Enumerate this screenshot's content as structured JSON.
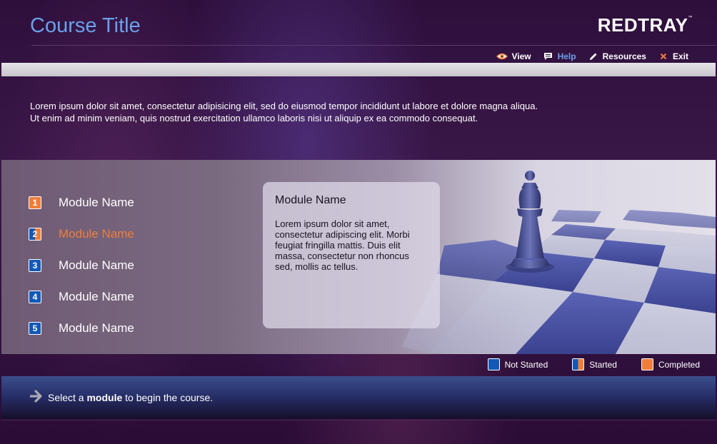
{
  "header": {
    "course_title": "Course Title",
    "logo_text": "REDTRAY",
    "logo_mark": "™"
  },
  "toolbar": {
    "items": [
      {
        "label": "View",
        "icon": "eye-icon",
        "active": false
      },
      {
        "label": "Help",
        "icon": "chat-icon",
        "active": true
      },
      {
        "label": "Resources",
        "icon": "pencil-icon",
        "active": false
      },
      {
        "label": "Exit",
        "icon": "close-icon",
        "active": false
      }
    ]
  },
  "intro": {
    "line1": "Lorem ipsum dolor sit amet, consectetur adipisicing elit, sed do eiusmod tempor incididunt ut labore et dolore magna aliqua.",
    "line2": "Ut enim ad minim veniam, quis nostrud exercitation ullamco laboris nisi ut aliquip ex ea commodo consequat."
  },
  "modules": [
    {
      "number": "1",
      "label": "Module Name",
      "status": "completed"
    },
    {
      "number": "2",
      "label": "Module Name",
      "status": "started"
    },
    {
      "number": "3",
      "label": "Module Name",
      "status": "notstarted"
    },
    {
      "number": "4",
      "label": "Module Name",
      "status": "notstarted"
    },
    {
      "number": "5",
      "label": "Module Name",
      "status": "notstarted"
    }
  ],
  "detail": {
    "title": "Module Name",
    "body": "Lorem ipsum dolor sit amet, consectetur adipiscing elit. Morbi feugiat fringilla mattis. Duis elit massa, consectetur non rhoncus sed, mollis ac tellus."
  },
  "legend": {
    "not_started": "Not Started",
    "started": "Started",
    "completed": "Completed"
  },
  "footer": {
    "text_before": "Select a",
    "text_bold": "module",
    "text_after": "to begin the course."
  },
  "colors": {
    "accent_blue": "#6aa0ea",
    "status_orange": "#f07e3a",
    "status_blue": "#1259b8"
  }
}
